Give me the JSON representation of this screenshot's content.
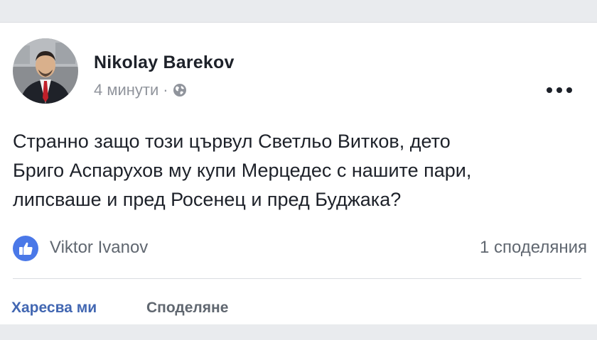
{
  "post": {
    "author": "Nikolay Barekov",
    "time": "4 минути",
    "separator": "·",
    "privacy_icon": "globe-icon",
    "more_icon": "more-dots-icon",
    "text_lines": [
      "Странно защо този цървул Светльо Витков, дето",
      "Бриго Аспарухов му купи Мерцедес с нашите пари,",
      "липсваше и пред Росенец и пред Буджака?"
    ]
  },
  "reactions": {
    "icon": "thumbs-up-icon",
    "reactor_name": "Viktor Ivanov",
    "shares_text": "1 споделяния"
  },
  "actions": {
    "like_label": "Харесва ми",
    "share_label": "Споделяне"
  },
  "colors": {
    "link_blue": "#4267b2",
    "like_badge": "#4a78e8",
    "text": "#1d2129",
    "muted": "#90949c",
    "page_bg": "#e9ebee"
  }
}
